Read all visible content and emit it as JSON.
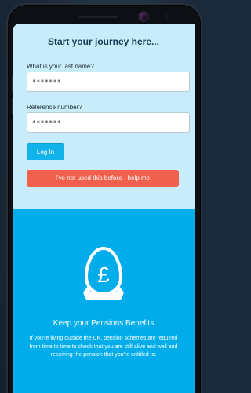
{
  "form": {
    "title": "Start your journey here...",
    "last_name_label": "What is your last name?",
    "last_name_value": "*******",
    "reference_label": "Reference number?",
    "reference_value": "*******",
    "login_label": "Log In",
    "help_label": "I've not used this before - help me"
  },
  "promo": {
    "icon": "pound-egg-icon",
    "title": "Keep your Pensions Benefits",
    "body": "If you're living outside the UK, pension schemes are required from time to time to check that you are still alive and well and receiving the pension that you're entitled to."
  },
  "colors": {
    "form_background": "#c9ecfa",
    "promo_background": "#00adea",
    "login_button": "#12b2ea",
    "help_button": "#f1604d",
    "title_text": "#163b55"
  }
}
